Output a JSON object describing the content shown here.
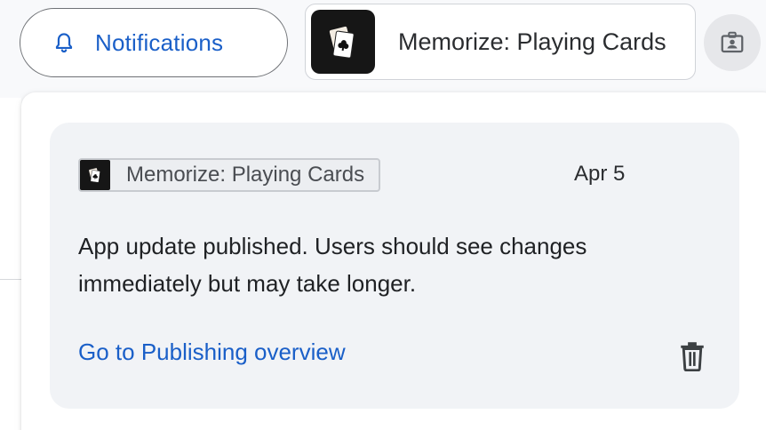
{
  "topbar": {
    "notifications_label": "Notifications",
    "bell_icon": "bell-icon",
    "app_name": "Memorize: Playing Cards",
    "account_icon": "badge-icon"
  },
  "notification": {
    "app_name": "Memorize: Playing Cards",
    "date": "Apr 5",
    "message": "App update published. Users should see changes immediately but may take longer.",
    "link_label": "Go to Publishing overview",
    "delete_icon": "trash-icon"
  },
  "colors": {
    "accent": "#1a5fc8",
    "card_bg": "#f1f3f6",
    "app_icon_bg": "#161616"
  }
}
